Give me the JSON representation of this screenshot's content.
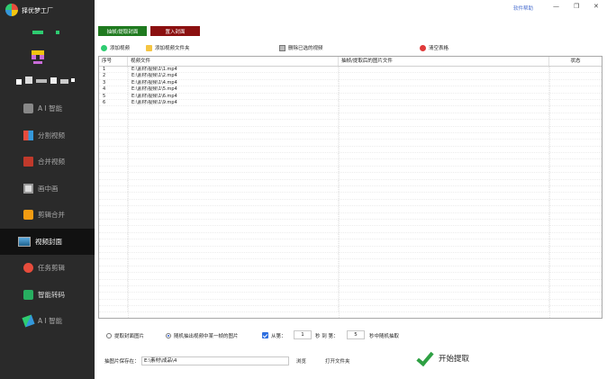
{
  "app": {
    "title": "择优梦工厂"
  },
  "topbar": {
    "help_link": "软件帮助",
    "min_icon": "minimize-icon",
    "restore_icon": "restore-icon",
    "close_icon": "close-icon"
  },
  "tabs": [
    {
      "label": "抽帧/提取封面",
      "color": "#1f7a1f"
    },
    {
      "label": "置入封面",
      "color": "#8b1010"
    }
  ],
  "sidebar": {
    "items": [
      {
        "label": "A I 智能",
        "icon": "robot-icon",
        "active": false
      },
      {
        "label": "分割视频",
        "icon": "split-icon",
        "active": false
      },
      {
        "label": "合并视频",
        "icon": "merge-icon",
        "active": false
      },
      {
        "label": "画中画",
        "icon": "picture-in-picture-icon",
        "active": false
      },
      {
        "label": "剪辑合并",
        "icon": "cut-icon",
        "active": false
      },
      {
        "label": "视频封面",
        "icon": "cover-icon",
        "active": true
      },
      {
        "label": "任务剪辑",
        "icon": "gear-icon",
        "active": false
      },
      {
        "label": "智能转码",
        "icon": "transcode-icon",
        "active": false
      },
      {
        "label": "A I 智能",
        "icon": "ai-tool-icon",
        "active": false
      }
    ]
  },
  "toolbar": {
    "add_video": "添加视频",
    "add_folder": "添加视频文件夹",
    "remove_selected": "删除已选的视频",
    "clear_table": "清空表格"
  },
  "table": {
    "headers": [
      "序号",
      "视频文件",
      "抽帧/提取后的图片文件",
      "状态"
    ],
    "rows": [
      {
        "index": "1",
        "file": "E:\\素材\\视频\\1\\1.mp4",
        "output": "",
        "status": ""
      },
      {
        "index": "2",
        "file": "E:\\素材\\视频\\1\\2.mp4",
        "output": "",
        "status": ""
      },
      {
        "index": "3",
        "file": "E:\\素材\\视频\\1\\4.mp4",
        "output": "",
        "status": ""
      },
      {
        "index": "4",
        "file": "E:\\素材\\视频\\1\\5.mp4",
        "output": "",
        "status": ""
      },
      {
        "index": "5",
        "file": "E:\\素材\\视频\\1\\6.mp4",
        "output": "",
        "status": ""
      },
      {
        "index": "6",
        "file": "E:\\素材\\视频\\1\\9.mp4",
        "output": "",
        "status": ""
      }
    ]
  },
  "options": {
    "extract_cover": "提取封面图片",
    "random_frame": "随机抽出视频中某一帧的图片",
    "range_from_label": "从第：",
    "range_from_value": "1",
    "seconds_to": "秒 到 第：",
    "range_to_value": "5",
    "random_suffix": "秒中随机抽取",
    "random_frame_selected": true,
    "range_checked": true
  },
  "bottom": {
    "save_label": "抽图片保存在：",
    "save_path": "E:\\素材\\成品\\4",
    "browse": "浏览",
    "open_folder": "打开文件夹",
    "start": "开始提取"
  }
}
